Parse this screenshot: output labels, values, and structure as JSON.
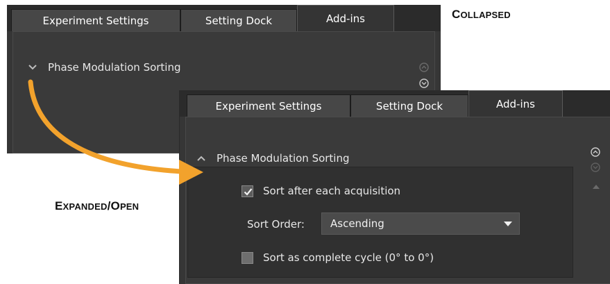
{
  "labels": {
    "collapsed": {
      "first": "C",
      "rest": "OLLAPSED"
    },
    "expanded": {
      "first_a": "E",
      "rest_a": "XPANDED",
      "slash": "/",
      "first_b": "O",
      "rest_b": "PEN"
    }
  },
  "collapsed_panel": {
    "tabs": [
      "Experiment Settings",
      "Setting Dock",
      "Add-ins"
    ],
    "active_tab": "Add-ins",
    "section_title": "Phase Modulation Sorting",
    "section_state": "collapsed"
  },
  "expanded_panel": {
    "tabs": [
      "Experiment Settings",
      "Setting Dock",
      "Add-ins"
    ],
    "active_tab": "Add-ins",
    "section_title": "Phase Modulation Sorting",
    "section_state": "expanded",
    "options": {
      "sort_after_each": {
        "label": "Sort after each acquisition",
        "checked": true
      },
      "sort_order": {
        "label": "Sort Order:",
        "value": "Ascending"
      },
      "complete_cycle": {
        "label": "Sort as complete cycle (0° to 0°)",
        "checked": false
      }
    }
  },
  "colors": {
    "arrow": "#f2a22c",
    "panel_bg": "#363636",
    "text": "#e8e8e8"
  }
}
